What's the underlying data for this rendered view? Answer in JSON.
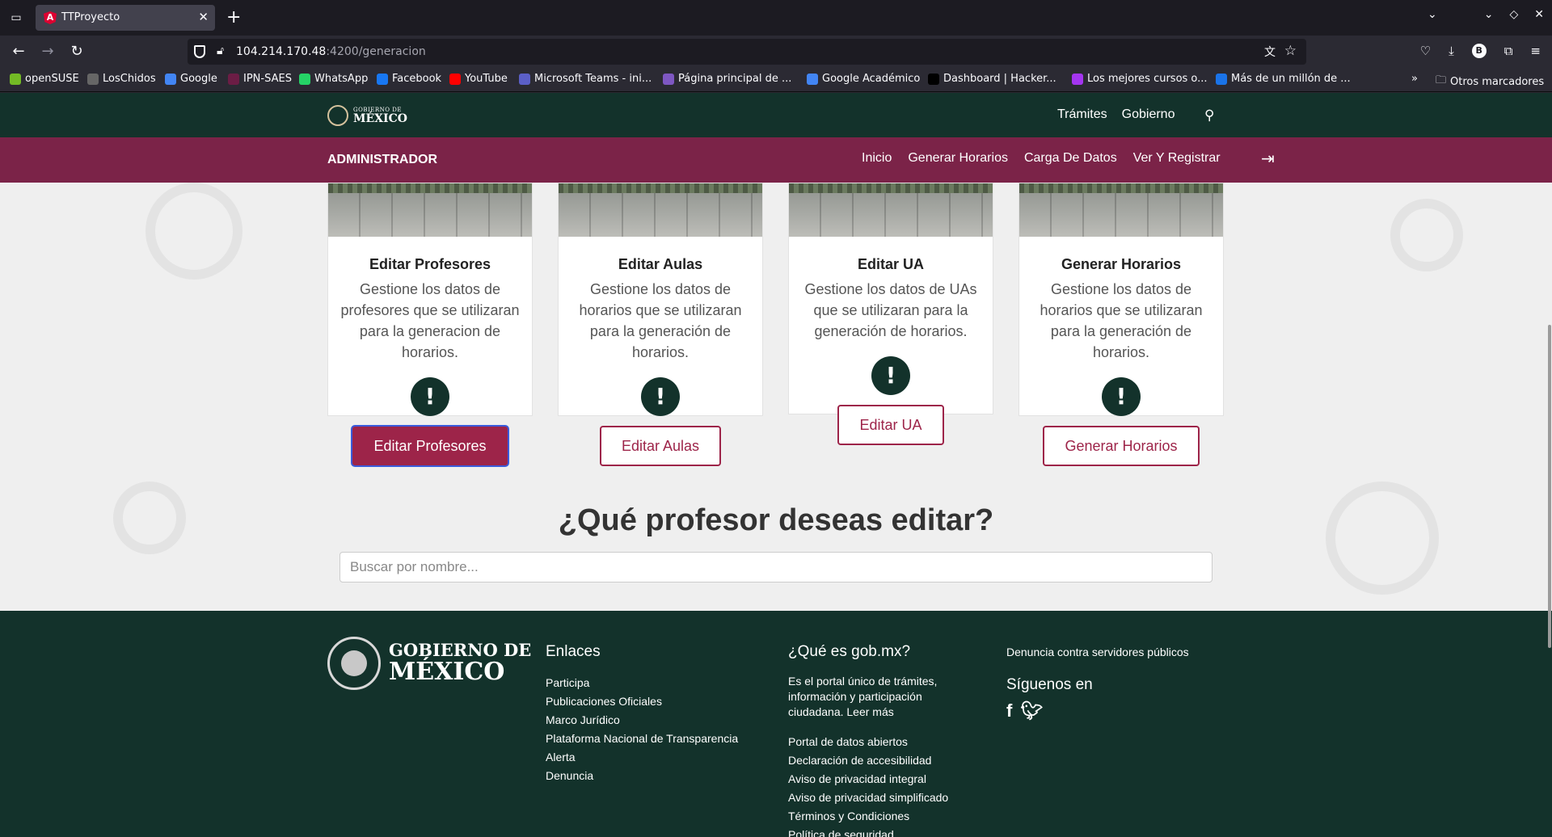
{
  "browser": {
    "tab_title": "TTProyecto",
    "url_host": "104.214.170.48",
    "url_path": ":4200/generacion",
    "bookmarks": [
      {
        "label": "openSUSE",
        "color": "#73ba25"
      },
      {
        "label": "LosChidos",
        "color": "#666666"
      },
      {
        "label": "Google",
        "color": "#4285f4"
      },
      {
        "label": "IPN-SAES",
        "color": "#6c1d45"
      },
      {
        "label": "WhatsApp",
        "color": "#25d366"
      },
      {
        "label": "Facebook",
        "color": "#1877f2"
      },
      {
        "label": "YouTube",
        "color": "#ff0000"
      },
      {
        "label": "Microsoft Teams - ini...",
        "color": "#5b5fc7"
      },
      {
        "label": "Página principal de ...",
        "color": "#7e57c2"
      },
      {
        "label": "Google Académico",
        "color": "#4285f4"
      },
      {
        "label": "Dashboard | Hacker...",
        "color": "#000000"
      },
      {
        "label": "Los mejores cursos o...",
        "color": "#a435f0"
      },
      {
        "label": "Más de un millón de ...",
        "color": "#1a73e8"
      }
    ],
    "other_bookmarks": "Otros marcadores"
  },
  "gob_header": {
    "logo_small": "GOBIERNO DE",
    "logo_big": "MÉXICO",
    "links": [
      "Trámites",
      "Gobierno"
    ]
  },
  "admin_bar": {
    "title": "ADMINISTRADOR",
    "links": [
      "Inicio",
      "Generar Horarios",
      "Carga De Datos",
      "Ver Y Registrar"
    ]
  },
  "cards": [
    {
      "title": "Editar Profesores",
      "text": "Gestione los datos de profesores que se utilizaran para la generacion de horarios.",
      "button": "Editar Profesores"
    },
    {
      "title": "Editar Aulas",
      "text": "Gestione los datos de horarios que se utilizaran para la generación de horarios.",
      "button": "Editar Aulas"
    },
    {
      "title": "Editar UA",
      "text": "Gestione los datos de UAs que se utilizaran para la generación de horarios.",
      "button": "Editar UA"
    },
    {
      "title": "Generar Horarios",
      "text": "Gestione los datos de horarios que se utilizaran para la generación de horarios.",
      "button": "Generar Horarios"
    }
  ],
  "question": "¿Qué profesor deseas editar?",
  "search": {
    "placeholder": "Buscar por nombre..."
  },
  "footer": {
    "logo_line1": "GOBIERNO DE",
    "logo_line2": "MÉXICO",
    "enlaces_title": "Enlaces",
    "enlaces": [
      "Participa",
      "Publicaciones Oficiales",
      "Marco Jurídico",
      "Plataforma Nacional de Transparencia",
      "Alerta",
      "Denuncia"
    ],
    "que_es_title": "¿Qué es gob.mx?",
    "que_es_text": "Es el portal único de trámites, información y participación ciudadana. Leer más",
    "que_es_links": [
      "Portal de datos abiertos",
      "Declaración de accesibilidad",
      "Aviso de privacidad integral",
      "Aviso de privacidad simplificado",
      "Términos y Condiciones",
      "Política de seguridad"
    ],
    "denuncia": "Denuncia contra servidores públicos",
    "siguenos": "Síguenos en"
  }
}
